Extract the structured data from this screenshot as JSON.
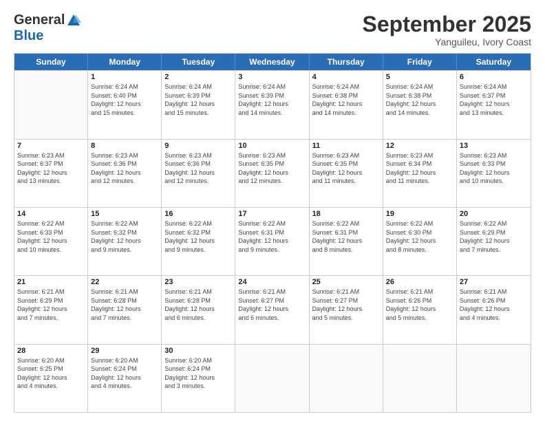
{
  "logo": {
    "general": "General",
    "blue": "Blue"
  },
  "title": "September 2025",
  "subtitle": "Yanguileu, Ivory Coast",
  "header_days": [
    "Sunday",
    "Monday",
    "Tuesday",
    "Wednesday",
    "Thursday",
    "Friday",
    "Saturday"
  ],
  "rows": [
    [
      {
        "day": "",
        "lines": []
      },
      {
        "day": "1",
        "lines": [
          "Sunrise: 6:24 AM",
          "Sunset: 6:40 PM",
          "Daylight: 12 hours",
          "and 15 minutes."
        ]
      },
      {
        "day": "2",
        "lines": [
          "Sunrise: 6:24 AM",
          "Sunset: 6:39 PM",
          "Daylight: 12 hours",
          "and 15 minutes."
        ]
      },
      {
        "day": "3",
        "lines": [
          "Sunrise: 6:24 AM",
          "Sunset: 6:39 PM",
          "Daylight: 12 hours",
          "and 14 minutes."
        ]
      },
      {
        "day": "4",
        "lines": [
          "Sunrise: 6:24 AM",
          "Sunset: 6:38 PM",
          "Daylight: 12 hours",
          "and 14 minutes."
        ]
      },
      {
        "day": "5",
        "lines": [
          "Sunrise: 6:24 AM",
          "Sunset: 6:38 PM",
          "Daylight: 12 hours",
          "and 14 minutes."
        ]
      },
      {
        "day": "6",
        "lines": [
          "Sunrise: 6:24 AM",
          "Sunset: 6:37 PM",
          "Daylight: 12 hours",
          "and 13 minutes."
        ]
      }
    ],
    [
      {
        "day": "7",
        "lines": [
          "Sunrise: 6:23 AM",
          "Sunset: 6:37 PM",
          "Daylight: 12 hours",
          "and 13 minutes."
        ]
      },
      {
        "day": "8",
        "lines": [
          "Sunrise: 6:23 AM",
          "Sunset: 6:36 PM",
          "Daylight: 12 hours",
          "and 12 minutes."
        ]
      },
      {
        "day": "9",
        "lines": [
          "Sunrise: 6:23 AM",
          "Sunset: 6:36 PM",
          "Daylight: 12 hours",
          "and 12 minutes."
        ]
      },
      {
        "day": "10",
        "lines": [
          "Sunrise: 6:23 AM",
          "Sunset: 6:35 PM",
          "Daylight: 12 hours",
          "and 12 minutes."
        ]
      },
      {
        "day": "11",
        "lines": [
          "Sunrise: 6:23 AM",
          "Sunset: 6:35 PM",
          "Daylight: 12 hours",
          "and 11 minutes."
        ]
      },
      {
        "day": "12",
        "lines": [
          "Sunrise: 6:23 AM",
          "Sunset: 6:34 PM",
          "Daylight: 12 hours",
          "and 11 minutes."
        ]
      },
      {
        "day": "13",
        "lines": [
          "Sunrise: 6:23 AM",
          "Sunset: 6:33 PM",
          "Daylight: 12 hours",
          "and 10 minutes."
        ]
      }
    ],
    [
      {
        "day": "14",
        "lines": [
          "Sunrise: 6:22 AM",
          "Sunset: 6:33 PM",
          "Daylight: 12 hours",
          "and 10 minutes."
        ]
      },
      {
        "day": "15",
        "lines": [
          "Sunrise: 6:22 AM",
          "Sunset: 6:32 PM",
          "Daylight: 12 hours",
          "and 9 minutes."
        ]
      },
      {
        "day": "16",
        "lines": [
          "Sunrise: 6:22 AM",
          "Sunset: 6:32 PM",
          "Daylight: 12 hours",
          "and 9 minutes."
        ]
      },
      {
        "day": "17",
        "lines": [
          "Sunrise: 6:22 AM",
          "Sunset: 6:31 PM",
          "Daylight: 12 hours",
          "and 9 minutes."
        ]
      },
      {
        "day": "18",
        "lines": [
          "Sunrise: 6:22 AM",
          "Sunset: 6:31 PM",
          "Daylight: 12 hours",
          "and 8 minutes."
        ]
      },
      {
        "day": "19",
        "lines": [
          "Sunrise: 6:22 AM",
          "Sunset: 6:30 PM",
          "Daylight: 12 hours",
          "and 8 minutes."
        ]
      },
      {
        "day": "20",
        "lines": [
          "Sunrise: 6:22 AM",
          "Sunset: 6:29 PM",
          "Daylight: 12 hours",
          "and 7 minutes."
        ]
      }
    ],
    [
      {
        "day": "21",
        "lines": [
          "Sunrise: 6:21 AM",
          "Sunset: 6:29 PM",
          "Daylight: 12 hours",
          "and 7 minutes."
        ]
      },
      {
        "day": "22",
        "lines": [
          "Sunrise: 6:21 AM",
          "Sunset: 6:28 PM",
          "Daylight: 12 hours",
          "and 7 minutes."
        ]
      },
      {
        "day": "23",
        "lines": [
          "Sunrise: 6:21 AM",
          "Sunset: 6:28 PM",
          "Daylight: 12 hours",
          "and 6 minutes."
        ]
      },
      {
        "day": "24",
        "lines": [
          "Sunrise: 6:21 AM",
          "Sunset: 6:27 PM",
          "Daylight: 12 hours",
          "and 6 minutes."
        ]
      },
      {
        "day": "25",
        "lines": [
          "Sunrise: 6:21 AM",
          "Sunset: 6:27 PM",
          "Daylight: 12 hours",
          "and 5 minutes."
        ]
      },
      {
        "day": "26",
        "lines": [
          "Sunrise: 6:21 AM",
          "Sunset: 6:26 PM",
          "Daylight: 12 hours",
          "and 5 minutes."
        ]
      },
      {
        "day": "27",
        "lines": [
          "Sunrise: 6:21 AM",
          "Sunset: 6:26 PM",
          "Daylight: 12 hours",
          "and 4 minutes."
        ]
      }
    ],
    [
      {
        "day": "28",
        "lines": [
          "Sunrise: 6:20 AM",
          "Sunset: 6:25 PM",
          "Daylight: 12 hours",
          "and 4 minutes."
        ]
      },
      {
        "day": "29",
        "lines": [
          "Sunrise: 6:20 AM",
          "Sunset: 6:24 PM",
          "Daylight: 12 hours",
          "and 4 minutes."
        ]
      },
      {
        "day": "30",
        "lines": [
          "Sunrise: 6:20 AM",
          "Sunset: 6:24 PM",
          "Daylight: 12 hours",
          "and 3 minutes."
        ]
      },
      {
        "day": "",
        "lines": []
      },
      {
        "day": "",
        "lines": []
      },
      {
        "day": "",
        "lines": []
      },
      {
        "day": "",
        "lines": []
      }
    ]
  ]
}
